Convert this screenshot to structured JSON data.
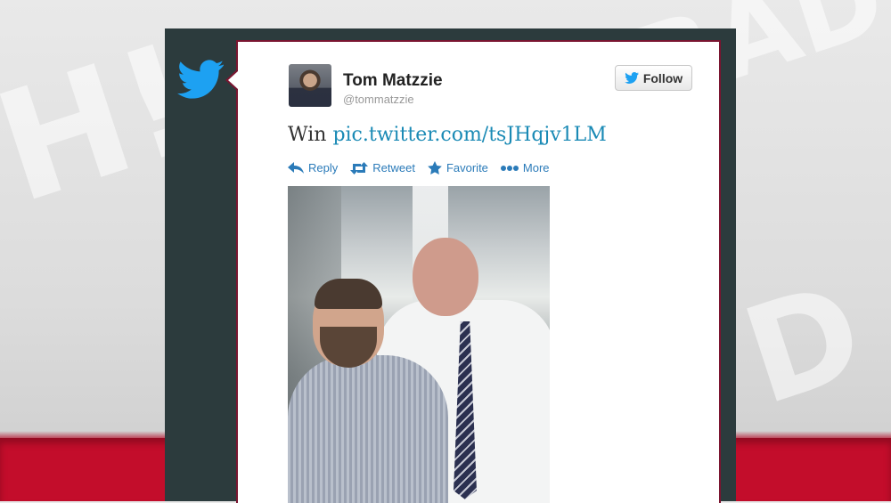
{
  "tweet": {
    "author_name": "Tom Matzzie",
    "author_handle": "@tommatzzie",
    "follow_label": "Follow",
    "text_prefix": "Win",
    "text_link": "pic.twitter.com/tsJHqjv1LM"
  },
  "actions": [
    {
      "label": "Reply",
      "icon": "reply-icon"
    },
    {
      "label": "Retweet",
      "icon": "retweet-icon"
    },
    {
      "label": "Favorite",
      "icon": "star-icon"
    },
    {
      "label": "More",
      "icon": "more-dots-icon"
    }
  ],
  "colors": {
    "twitter_blue": "#1da1f2",
    "link": "#1a8ab5",
    "frame": "#2c3b3d",
    "accent_red": "#c30d2b"
  }
}
